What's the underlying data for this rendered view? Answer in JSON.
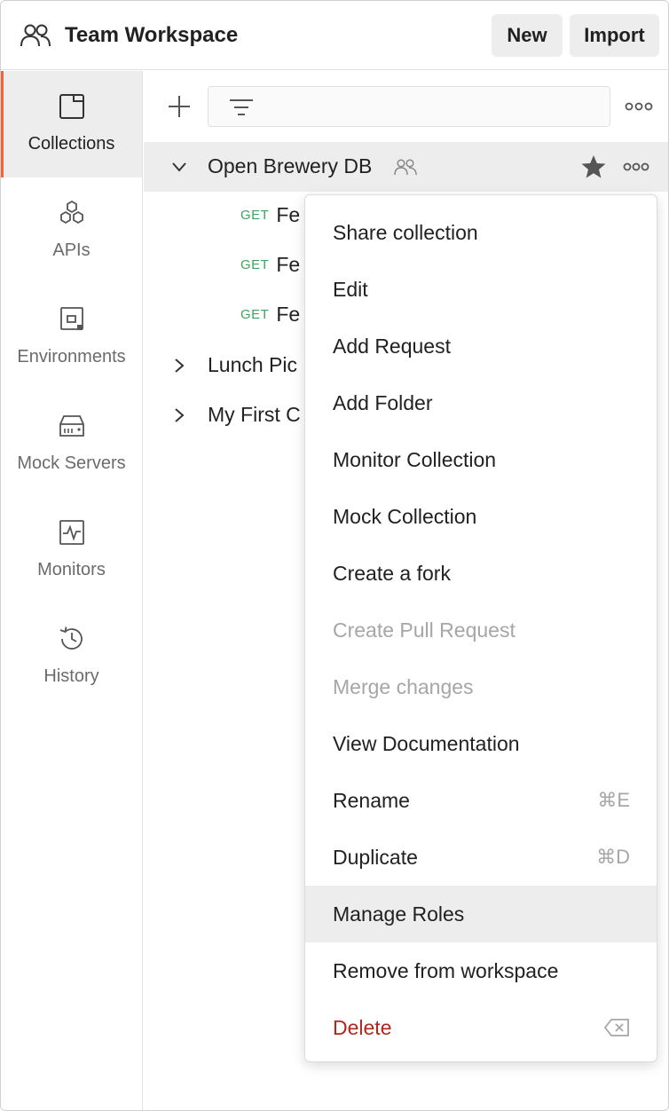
{
  "header": {
    "workspace_icon": "team-icon",
    "title": "Team Workspace",
    "new_label": "New",
    "import_label": "Import"
  },
  "sidebar": {
    "items": [
      {
        "label": "Collections",
        "icon": "collection-icon",
        "active": true
      },
      {
        "label": "APIs",
        "icon": "apis-icon",
        "active": false
      },
      {
        "label": "Environments",
        "icon": "environments-icon",
        "active": false
      },
      {
        "label": "Mock Servers",
        "icon": "mock-server-icon",
        "active": false
      },
      {
        "label": "Monitors",
        "icon": "monitor-icon",
        "active": false
      },
      {
        "label": "History",
        "icon": "history-icon",
        "active": false
      }
    ]
  },
  "toolbar": {
    "add_icon": "plus-icon",
    "filter_icon": "filter-icon",
    "more_icon": "more-horizontal-icon",
    "filter_value": ""
  },
  "tree": {
    "open_collection": {
      "name": "Open Brewery DB",
      "shared": true,
      "starred": true
    },
    "requests": [
      {
        "method": "GET",
        "name": "Fe"
      },
      {
        "method": "GET",
        "name": "Fe"
      },
      {
        "method": "GET",
        "name": "Fe"
      }
    ],
    "collapsed_collections": [
      {
        "name": "Lunch Pic"
      },
      {
        "name": "My First C"
      }
    ]
  },
  "context_menu": {
    "items": [
      {
        "label": "Share collection",
        "state": "normal"
      },
      {
        "label": "Edit",
        "state": "normal"
      },
      {
        "label": "Add Request",
        "state": "normal"
      },
      {
        "label": "Add Folder",
        "state": "normal"
      },
      {
        "label": "Monitor Collection",
        "state": "normal"
      },
      {
        "label": "Mock Collection",
        "state": "normal"
      },
      {
        "label": "Create a fork",
        "state": "normal"
      },
      {
        "label": "Create Pull Request",
        "state": "disabled"
      },
      {
        "label": "Merge changes",
        "state": "disabled"
      },
      {
        "label": "View Documentation",
        "state": "normal"
      },
      {
        "label": "Rename",
        "state": "normal",
        "shortcut": "⌘E"
      },
      {
        "label": "Duplicate",
        "state": "normal",
        "shortcut": "⌘D"
      },
      {
        "label": "Manage Roles",
        "state": "hover"
      },
      {
        "label": "Remove from workspace",
        "state": "normal"
      },
      {
        "label": "Delete",
        "state": "danger",
        "shortcut_icon": "backspace-icon"
      }
    ]
  },
  "colors": {
    "accent": "#e8673c",
    "get_method": "#3ba55c",
    "danger": "#b3261e",
    "disabled_text": "#a6a6a6",
    "hover_bg": "#ededed"
  }
}
